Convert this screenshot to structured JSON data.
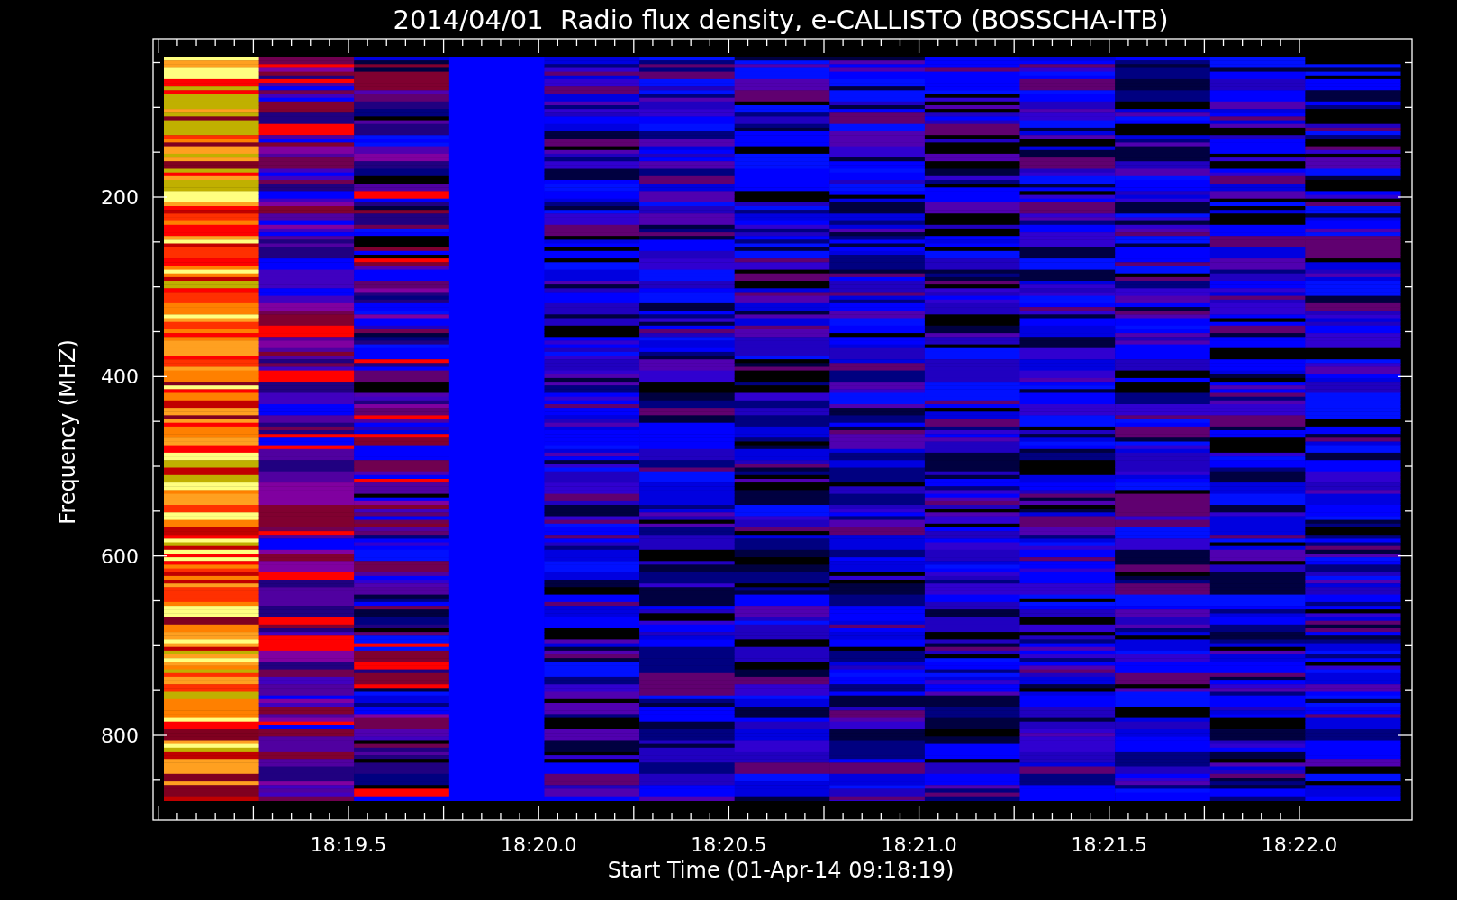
{
  "plot": {
    "title": "2014/04/01  Radio flux density, e-CALLISTO (BOSSCHA-ITB)",
    "y_axis": {
      "label": "Frequency (MHZ)",
      "ticks": [
        "200",
        "400",
        "600",
        "800"
      ]
    },
    "x_axis": {
      "label": "Start Time (01-Apr-14 09:18:19)",
      "ticks": [
        "18:19.5",
        "18:20.0",
        "18:20.5",
        "18:21.0",
        "18:21.5",
        "18:22.0"
      ]
    }
  }
}
